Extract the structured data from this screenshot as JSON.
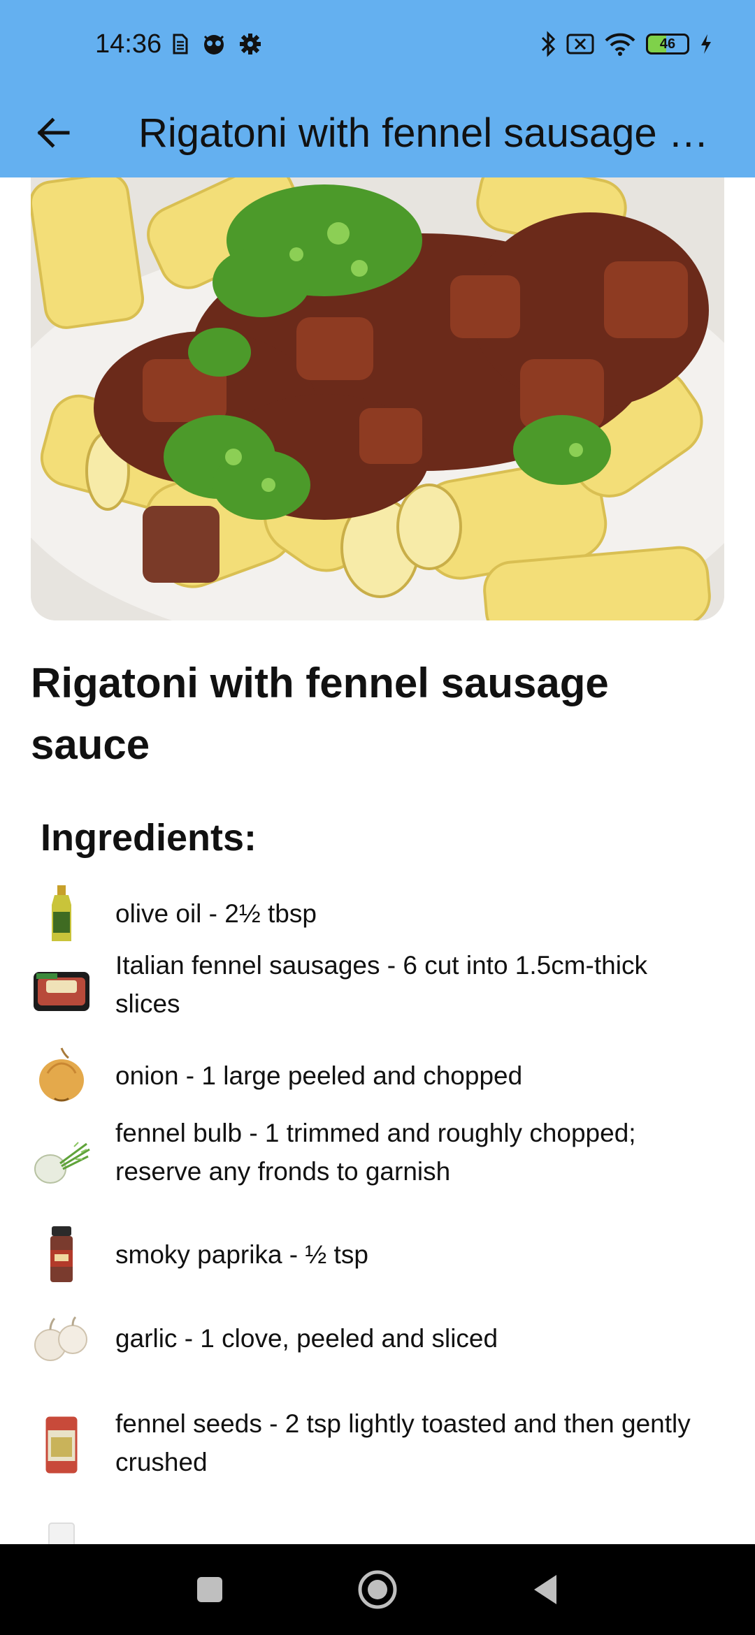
{
  "status_bar": {
    "time": "14:36",
    "battery": "46",
    "left_icons": [
      "sim-icon",
      "app-notification-icon",
      "gear-icon"
    ],
    "right_icons": [
      "bluetooth-icon",
      "no-sim-icon",
      "wifi-icon",
      "battery-icon",
      "charging-icon"
    ]
  },
  "app_bar": {
    "title": "Rigatoni with fennel sausage sauce",
    "back_icon": "arrow-left-icon"
  },
  "recipe": {
    "title": "Rigatoni with fennel sausage sauce",
    "ingredients_heading": "Ingredients:",
    "ingredients": [
      {
        "text": "olive oil - 2½ tbsp",
        "icon": "olive-oil-bottle-icon"
      },
      {
        "text": "Italian fennel sausages - 6 cut into 1.5cm-thick slices",
        "icon": "sausage-pack-icon"
      },
      {
        "text": "onion - 1 large peeled and chopped",
        "icon": "onion-icon"
      },
      {
        "text": "fennel bulb - 1 trimmed and roughly chopped; reserve any fronds to garnish",
        "icon": "fennel-bulb-icon"
      },
      {
        "text": "smoky paprika - ½ tsp",
        "icon": "paprika-jar-icon"
      },
      {
        "text": "garlic - 1 clove, peeled and sliced",
        "icon": "garlic-icon"
      },
      {
        "text": "fennel seeds - 2 tsp lightly toasted and then gently crushed",
        "icon": "fennel-seeds-pack-icon"
      }
    ]
  },
  "nav_bar": {
    "recents_icon": "square-icon",
    "home_icon": "circle-home-icon",
    "back_icon": "triangle-back-icon"
  },
  "colors": {
    "app_bar": "#64b0f0",
    "nav_bar": "#000000",
    "text": "#111111",
    "battery_fill": "#7fd14a"
  }
}
